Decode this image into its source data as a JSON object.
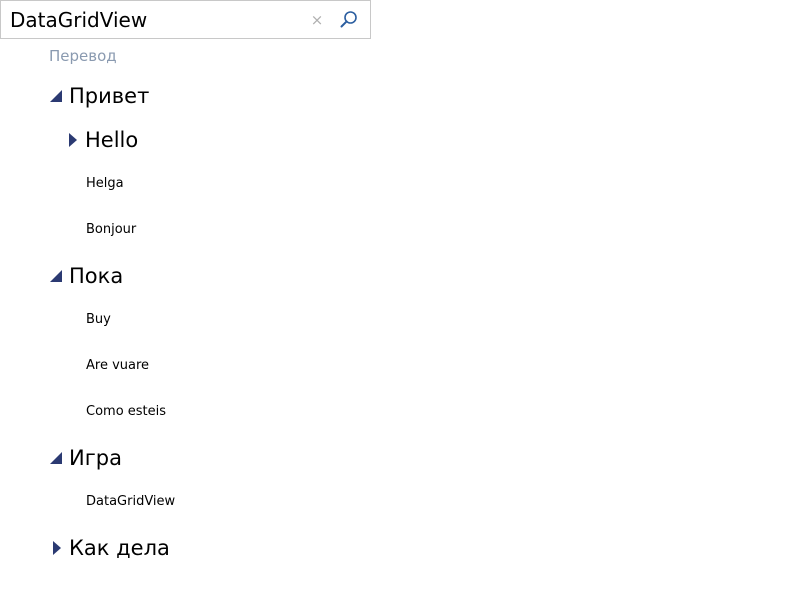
{
  "search": {
    "value": "DataGridView",
    "clear_glyph": "×"
  },
  "tree": {
    "group_header": "Перевод",
    "nodes": [
      {
        "label": "Привет",
        "expanded": true,
        "children": [
          {
            "label": "Hello",
            "expanded": false
          },
          {
            "label": "Helga"
          },
          {
            "label": "Bonjour"
          }
        ]
      },
      {
        "label": "Пока",
        "expanded": true,
        "children": [
          {
            "label": "Buy"
          },
          {
            "label": "Are vuare"
          },
          {
            "label": "Como esteis"
          }
        ]
      },
      {
        "label": "Игра",
        "expanded": true,
        "children": [
          {
            "label": "DataGridView"
          }
        ]
      },
      {
        "label": "Как дела",
        "expanded": false,
        "children": []
      }
    ]
  },
  "colors": {
    "toggle": "#2b3a72",
    "group_header": "#8a9ab0",
    "search_border": "#c8c8c8",
    "search_icon": "#2b5ea0"
  },
  "icons": {
    "expanded": "expanded-triangle-icon",
    "collapsed": "collapsed-triangle-icon",
    "search": "search-icon",
    "clear": "close-icon"
  }
}
